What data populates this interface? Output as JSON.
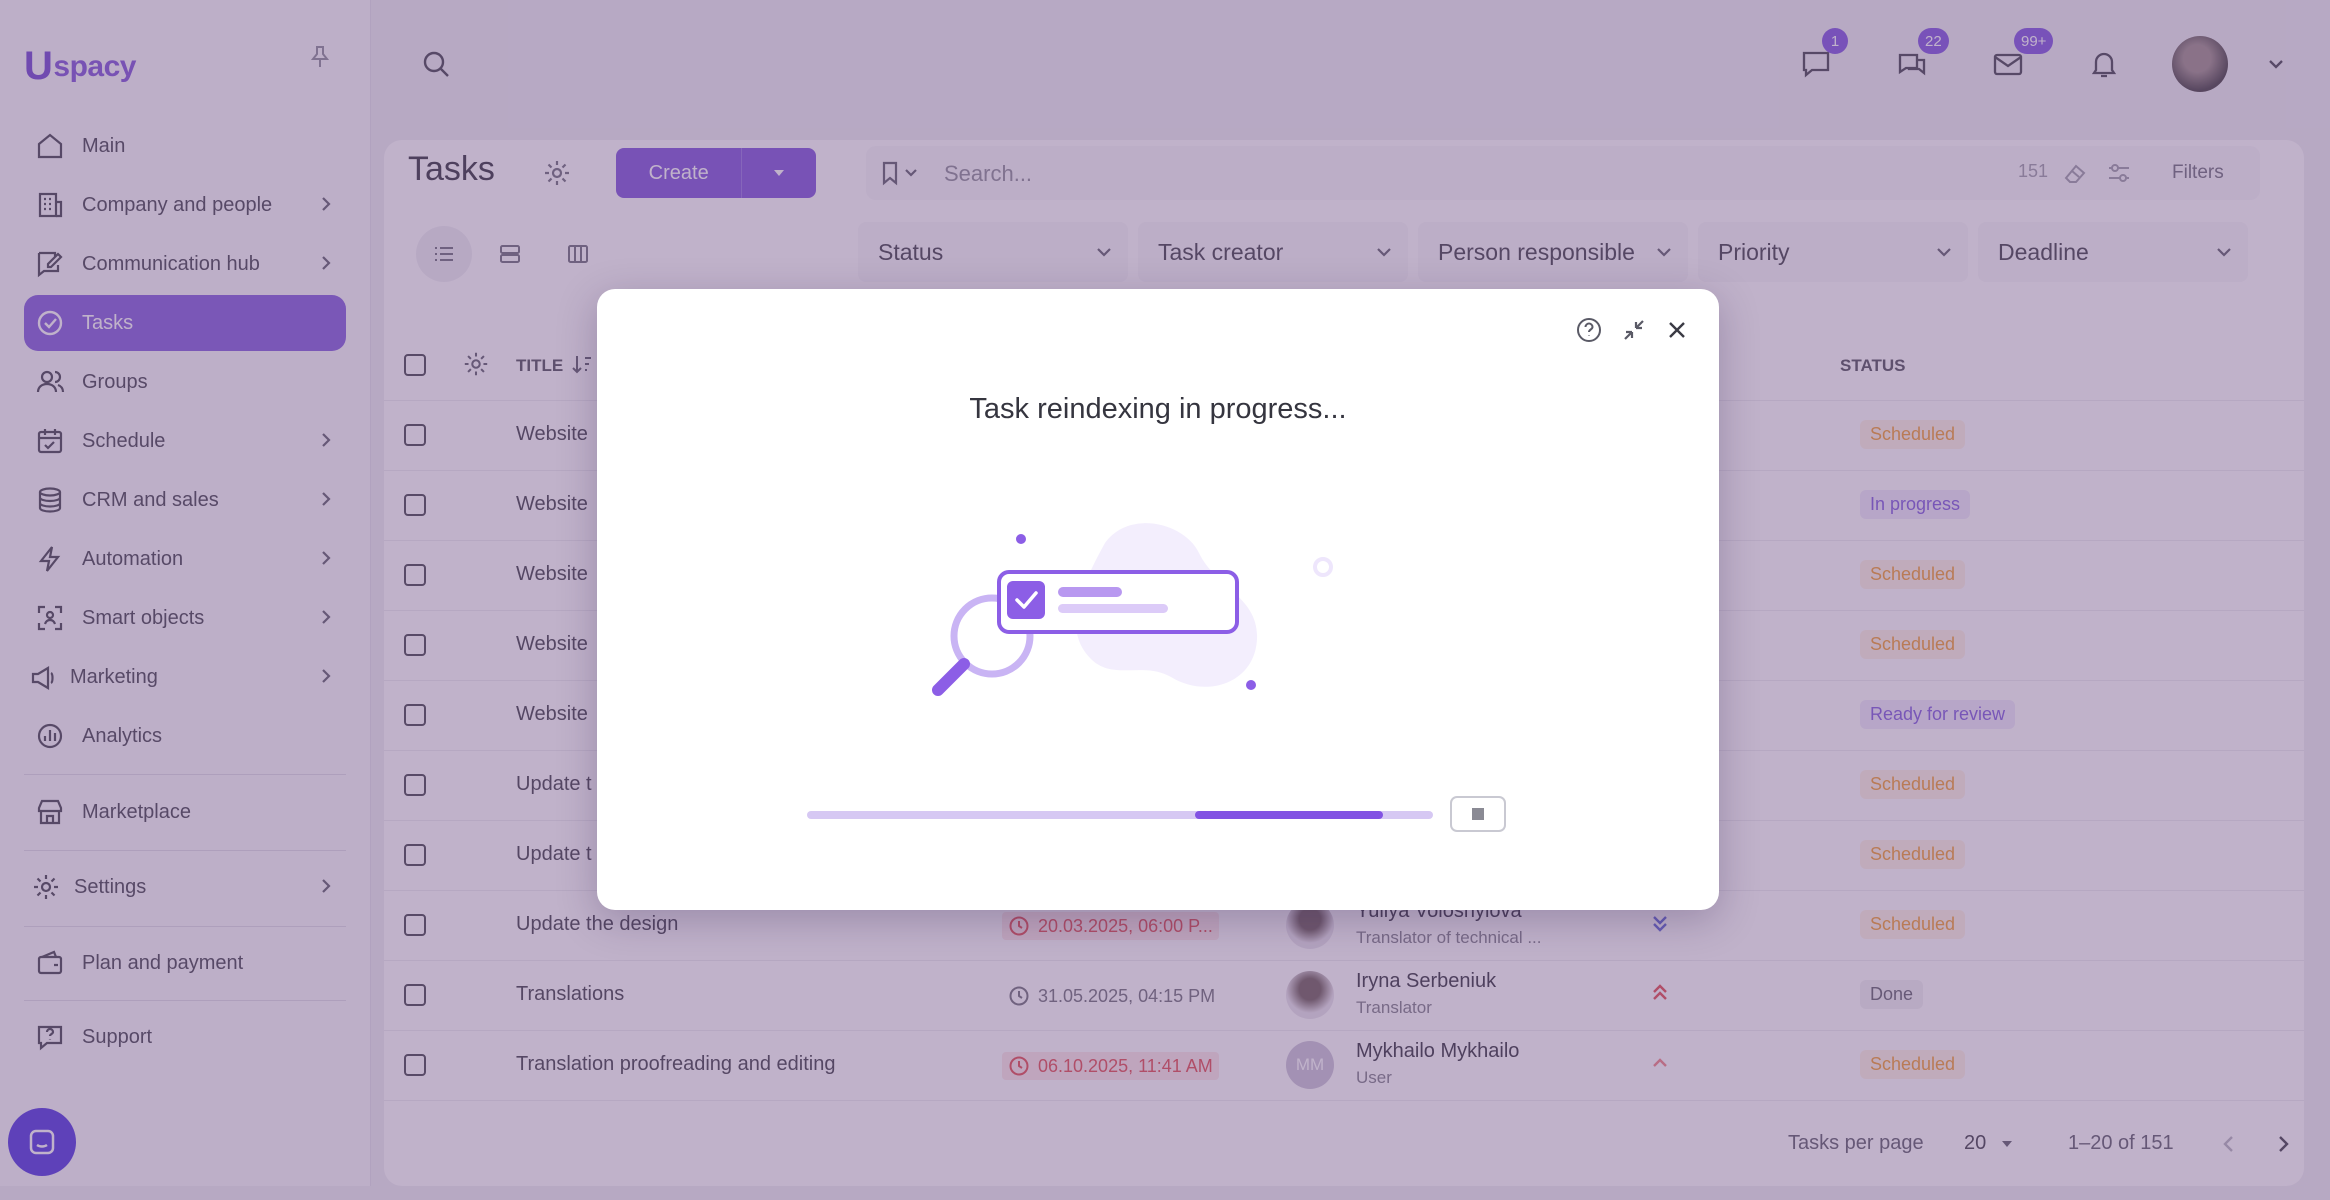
{
  "app": {
    "logo_text": "spacy",
    "logo_letter": "U"
  },
  "sidebar": {
    "items": [
      {
        "label": "Main",
        "icon": "home-icon"
      },
      {
        "label": "Company and people",
        "icon": "building-icon"
      },
      {
        "label": "Communication hub",
        "icon": "chat-edit-icon"
      },
      {
        "label": "Tasks",
        "icon": "check-circle-icon"
      },
      {
        "label": "Groups",
        "icon": "users-icon"
      },
      {
        "label": "Schedule",
        "icon": "calendar-icon"
      },
      {
        "label": "CRM and sales",
        "icon": "database-icon"
      },
      {
        "label": "Automation",
        "icon": "lightning-icon"
      },
      {
        "label": "Smart objects",
        "icon": "scan-icon"
      },
      {
        "label": "Marketing",
        "icon": "megaphone-icon"
      },
      {
        "label": "Analytics",
        "icon": "chart-icon"
      }
    ],
    "marketplace": "Marketplace",
    "settings": "Settings",
    "plan": "Plan and payment",
    "support": "Support"
  },
  "topbar": {
    "badges": {
      "chat": "1",
      "messenger": "22",
      "mail": "99+"
    }
  },
  "page": {
    "title": "Tasks",
    "create_label": "Create",
    "search_placeholder": "Search...",
    "count": "151",
    "filters_label": "Filters"
  },
  "filters": [
    "Status",
    "Task creator",
    "Person responsible",
    "Priority",
    "Deadline"
  ],
  "table": {
    "col_title": "TITLE",
    "col_status": "STATUS",
    "rows": [
      {
        "title": "Website",
        "status": "Scheduled",
        "status_kind": "scheduled"
      },
      {
        "title": "Website",
        "status": "In progress",
        "status_kind": "inprogress"
      },
      {
        "title": "Website",
        "status": "Scheduled",
        "status_kind": "scheduled"
      },
      {
        "title": "Website",
        "status": "Scheduled",
        "status_kind": "scheduled"
      },
      {
        "title": "Website",
        "status": "Ready for review",
        "status_kind": "review"
      },
      {
        "title": "Update t",
        "status": "Scheduled",
        "status_kind": "scheduled"
      },
      {
        "title": "Update t",
        "status": "Scheduled",
        "status_kind": "scheduled"
      },
      {
        "title": "Update the design",
        "deadline": "20.03.2025, 06:00 P...",
        "deadline_overdue": true,
        "person": "Yuliya Voloshylova",
        "role": "Translator of technical ...",
        "priority": "low",
        "status": "Scheduled",
        "status_kind": "scheduled"
      },
      {
        "title": "Translations",
        "deadline": "31.05.2025, 04:15 PM",
        "deadline_overdue": false,
        "person": "Iryna Serbeniuk",
        "role": "Translator",
        "priority": "high",
        "status": "Done",
        "status_kind": "done"
      },
      {
        "title": "Translation proofreading and editing",
        "deadline": "06.10.2025, 11:41 AM",
        "deadline_overdue": true,
        "person": "Mykhailo Mykhailo",
        "role": "User",
        "initials": "MM",
        "priority": "medium",
        "status": "Scheduled",
        "status_kind": "scheduled"
      }
    ]
  },
  "pagination": {
    "per_page_label": "Tasks per page",
    "per_page_value": "20",
    "range": "1–20 of 151"
  },
  "modal": {
    "title": "Task reindexing in progress...",
    "progress_start": 0.62,
    "progress_end": 0.92
  },
  "colors": {
    "accent": "#7a4fdb",
    "overlay": "#76588c",
    "scheduled": "#f39a2a",
    "overdue": "#e2474b"
  }
}
